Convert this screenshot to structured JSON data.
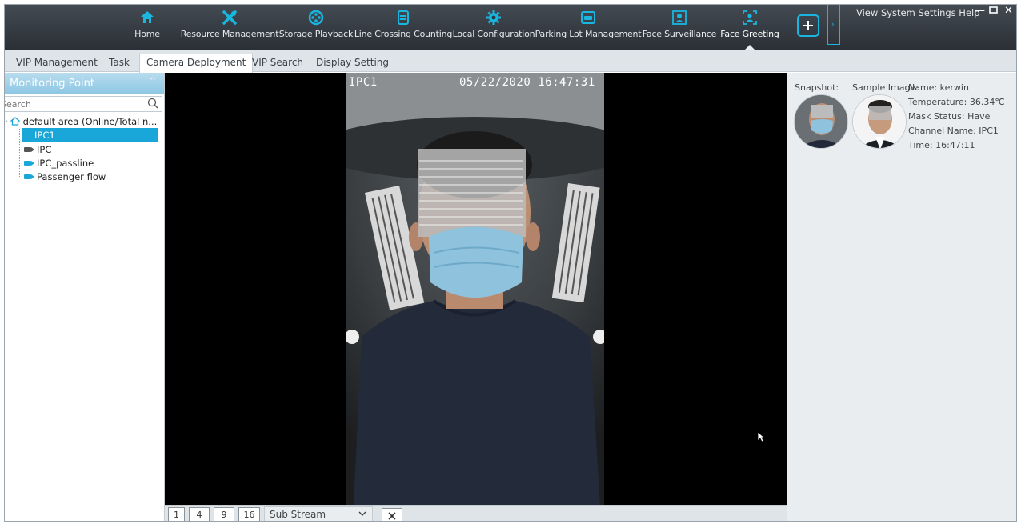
{
  "topnav": {
    "items": [
      {
        "label": "Home",
        "icon": "home-icon"
      },
      {
        "label": "Resource Management",
        "icon": "wrench-screwdriver-icon"
      },
      {
        "label": "Storage Playback",
        "icon": "film-reel-icon"
      },
      {
        "label": "Line Crossing Counting",
        "icon": "line-crossing-icon"
      },
      {
        "label": "Local Configuration",
        "icon": "gear-icon"
      },
      {
        "label": "Parking Lot Management",
        "icon": "car-icon"
      },
      {
        "label": "Face Surveillance",
        "icon": "face-surveillance-icon"
      },
      {
        "label": "Face Greeting",
        "icon": "face-greeting-icon"
      }
    ],
    "system_menu": "View  System  Settings  Help",
    "accent_color": "#19b6e0"
  },
  "subtabs": [
    "VIP Management",
    "Task",
    "Camera Deployment",
    "VIP Search",
    "Display Setting"
  ],
  "active_subtab": "Camera Deployment",
  "left_panel": {
    "title": "Monitoring Point",
    "search_placeholder": "Search",
    "tree": {
      "root": "default area (Online/Total n...",
      "children": [
        "IPC1",
        "IPC",
        "IPC_passline",
        "Passenger flow"
      ],
      "selected": "IPC1"
    }
  },
  "video": {
    "channel_osd": "IPC1",
    "timestamp_osd": "05/22/2020 16:47:31",
    "layouts": [
      "1",
      "4",
      "9",
      "16"
    ],
    "stream": "Sub Stream"
  },
  "right_panel": {
    "snapshot_label": "Snapshot:",
    "sample_label": "Sample Image:",
    "name": "Name: kerwin",
    "temperature": "Temperature: 36.34℃",
    "mask_status": "Mask Status: Have",
    "channel_name": "Channel Name: IPC1",
    "time": "Time: 16:47:11"
  }
}
